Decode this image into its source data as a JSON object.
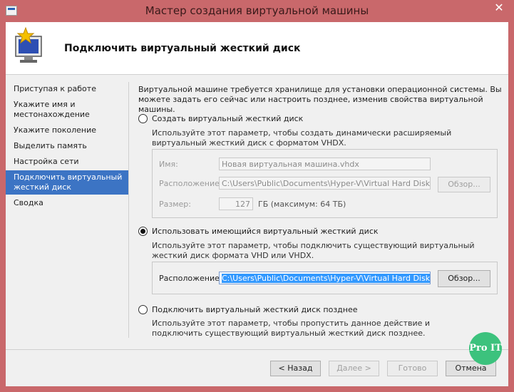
{
  "window": {
    "title": "Мастер создания виртуальной машины",
    "close_glyph": "✕"
  },
  "header": {
    "title": "Подключить виртуальный жесткий диск"
  },
  "nav": {
    "items": [
      {
        "label": "Приступая к работе"
      },
      {
        "label": "Укажите имя и местонахождение"
      },
      {
        "label": "Укажите поколение"
      },
      {
        "label": "Выделить память"
      },
      {
        "label": "Настройка сети"
      },
      {
        "label": "Подключить виртуальный жесткий диск",
        "active": true
      },
      {
        "label": "Сводка"
      }
    ]
  },
  "content": {
    "intro": "Виртуальной машине требуется хранилище для установки операционной системы. Вы можете задать его сейчас или настроить позднее, изменив свойства виртуальной машины.",
    "option_create": {
      "label": "Создать виртуальный жесткий диск",
      "desc": "Используйте этот параметр, чтобы создать динамически расширяемый виртуальный жесткий диск с форматом VHDX.",
      "name_label": "Имя:",
      "name_value": "Новая виртуальная машина.vhdx",
      "location_label": "Расположение:",
      "location_value": "C:\\Users\\Public\\Documents\\Hyper-V\\Virtual Hard Disks\\",
      "browse_label": "Обзор...",
      "size_label": "Размер:",
      "size_value": "127",
      "size_unit": "ГБ (максимум: 64 ТБ)"
    },
    "option_existing": {
      "label": "Использовать имеющийся виртуальный жесткий диск",
      "desc": "Используйте этот параметр, чтобы подключить существующий виртуальный жесткий диск формата VHD или VHDX.",
      "location_label": "Расположение:",
      "location_value": "C:\\Users\\Public\\Documents\\Hyper-V\\Virtual Hard Disks\\",
      "browse_label": "Обзор...",
      "selected": true
    },
    "option_later": {
      "label": "Подключить виртуальный жесткий диск позднее",
      "desc": "Используйте этот параметр, чтобы пропустить данное действие и подключить существующий виртуальный жесткий диск позднее."
    }
  },
  "footer": {
    "back": "< Назад",
    "next": "Далее >",
    "finish": "Готово",
    "cancel": "Отмена"
  },
  "watermark": {
    "text": "Pro IT"
  }
}
